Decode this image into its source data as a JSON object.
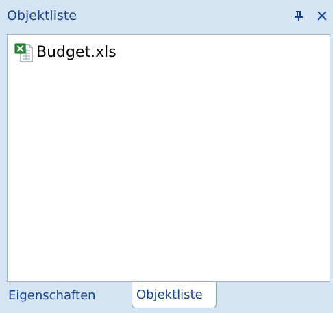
{
  "panel": {
    "title": "Objektliste",
    "pin_icon": "pin-icon",
    "close_icon": "close-icon"
  },
  "list": {
    "items": [
      {
        "label": "Budget.xls",
        "icon": "excel-file-icon"
      }
    ]
  },
  "tabs": [
    {
      "label": "Eigenschaften",
      "active": false
    },
    {
      "label": "Objektliste",
      "active": true
    }
  ],
  "colors": {
    "panel_bg": "#d5e4f3",
    "title_text": "#15428b",
    "content_bg": "#ffffff",
    "border": "#a0b4cf",
    "excel_green": "#2e8b3e"
  }
}
